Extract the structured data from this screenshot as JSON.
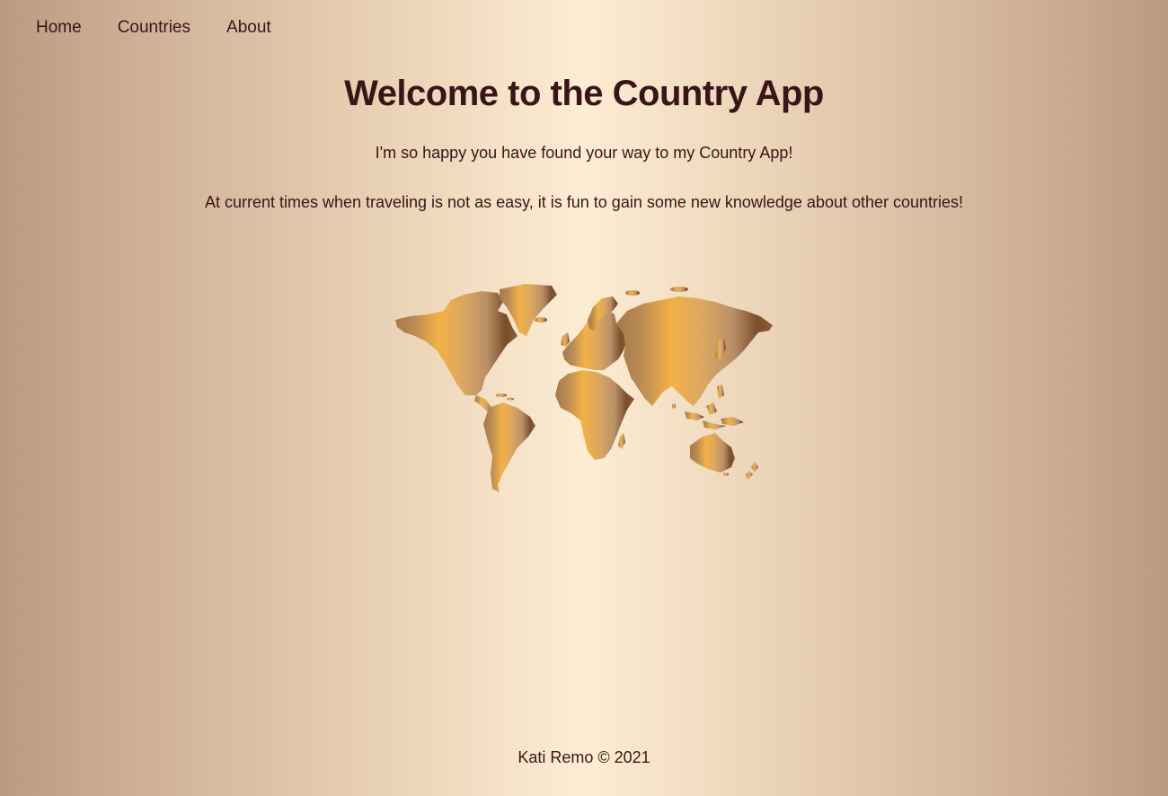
{
  "nav": {
    "items": [
      {
        "label": "Home"
      },
      {
        "label": "Countries"
      },
      {
        "label": "About"
      }
    ]
  },
  "main": {
    "title": "Welcome to the Country App",
    "paragraphs": [
      "I'm so happy you have found your way to my Country App!",
      "At current times when traveling is not as easy, it is fun to gain some new knowledge about other countries!"
    ],
    "image_icon": "world-map-icon"
  },
  "footer": {
    "text": "Kati Remo © 2021"
  },
  "colors": {
    "text": "#3a1518",
    "background_center": "#fdedd3",
    "background_edge": "#bc9a80",
    "map_gold": "#f2b146",
    "map_brown": "#7a4e2a"
  }
}
